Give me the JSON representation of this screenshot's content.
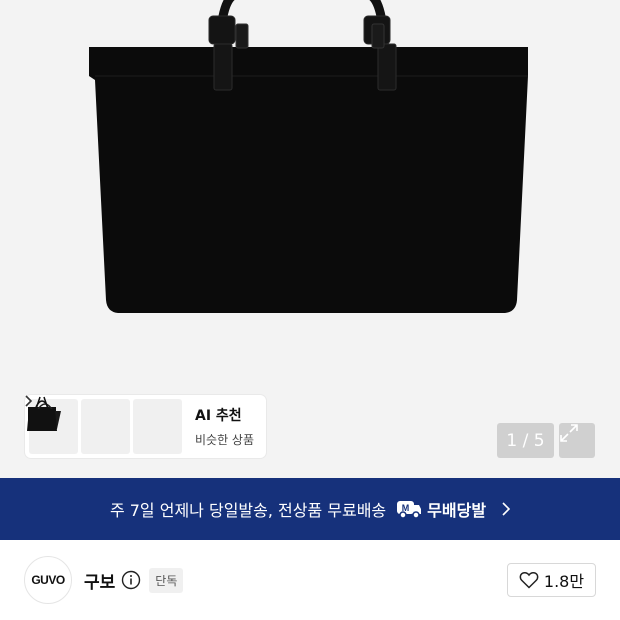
{
  "ai_recommend": {
    "title": "AI 추천",
    "subtitle": "비슷한 상품",
    "thumbnails": [
      "tote-bag-thumb-1",
      "tote-bag-thumb-2",
      "tote-bag-thumb-3"
    ]
  },
  "gallery": {
    "counter": "1 / 5",
    "expand_icon": "expand-icon"
  },
  "delivery_banner": {
    "text": "주 7일 언제나 당일발송, 전상품 무료배송",
    "brand": "무배당발",
    "icon": "delivery-truck-icon",
    "background": "#16317b"
  },
  "brand": {
    "logo_text": "GUVO",
    "name": "구보",
    "badge": "단독",
    "likes": "1.8만"
  }
}
